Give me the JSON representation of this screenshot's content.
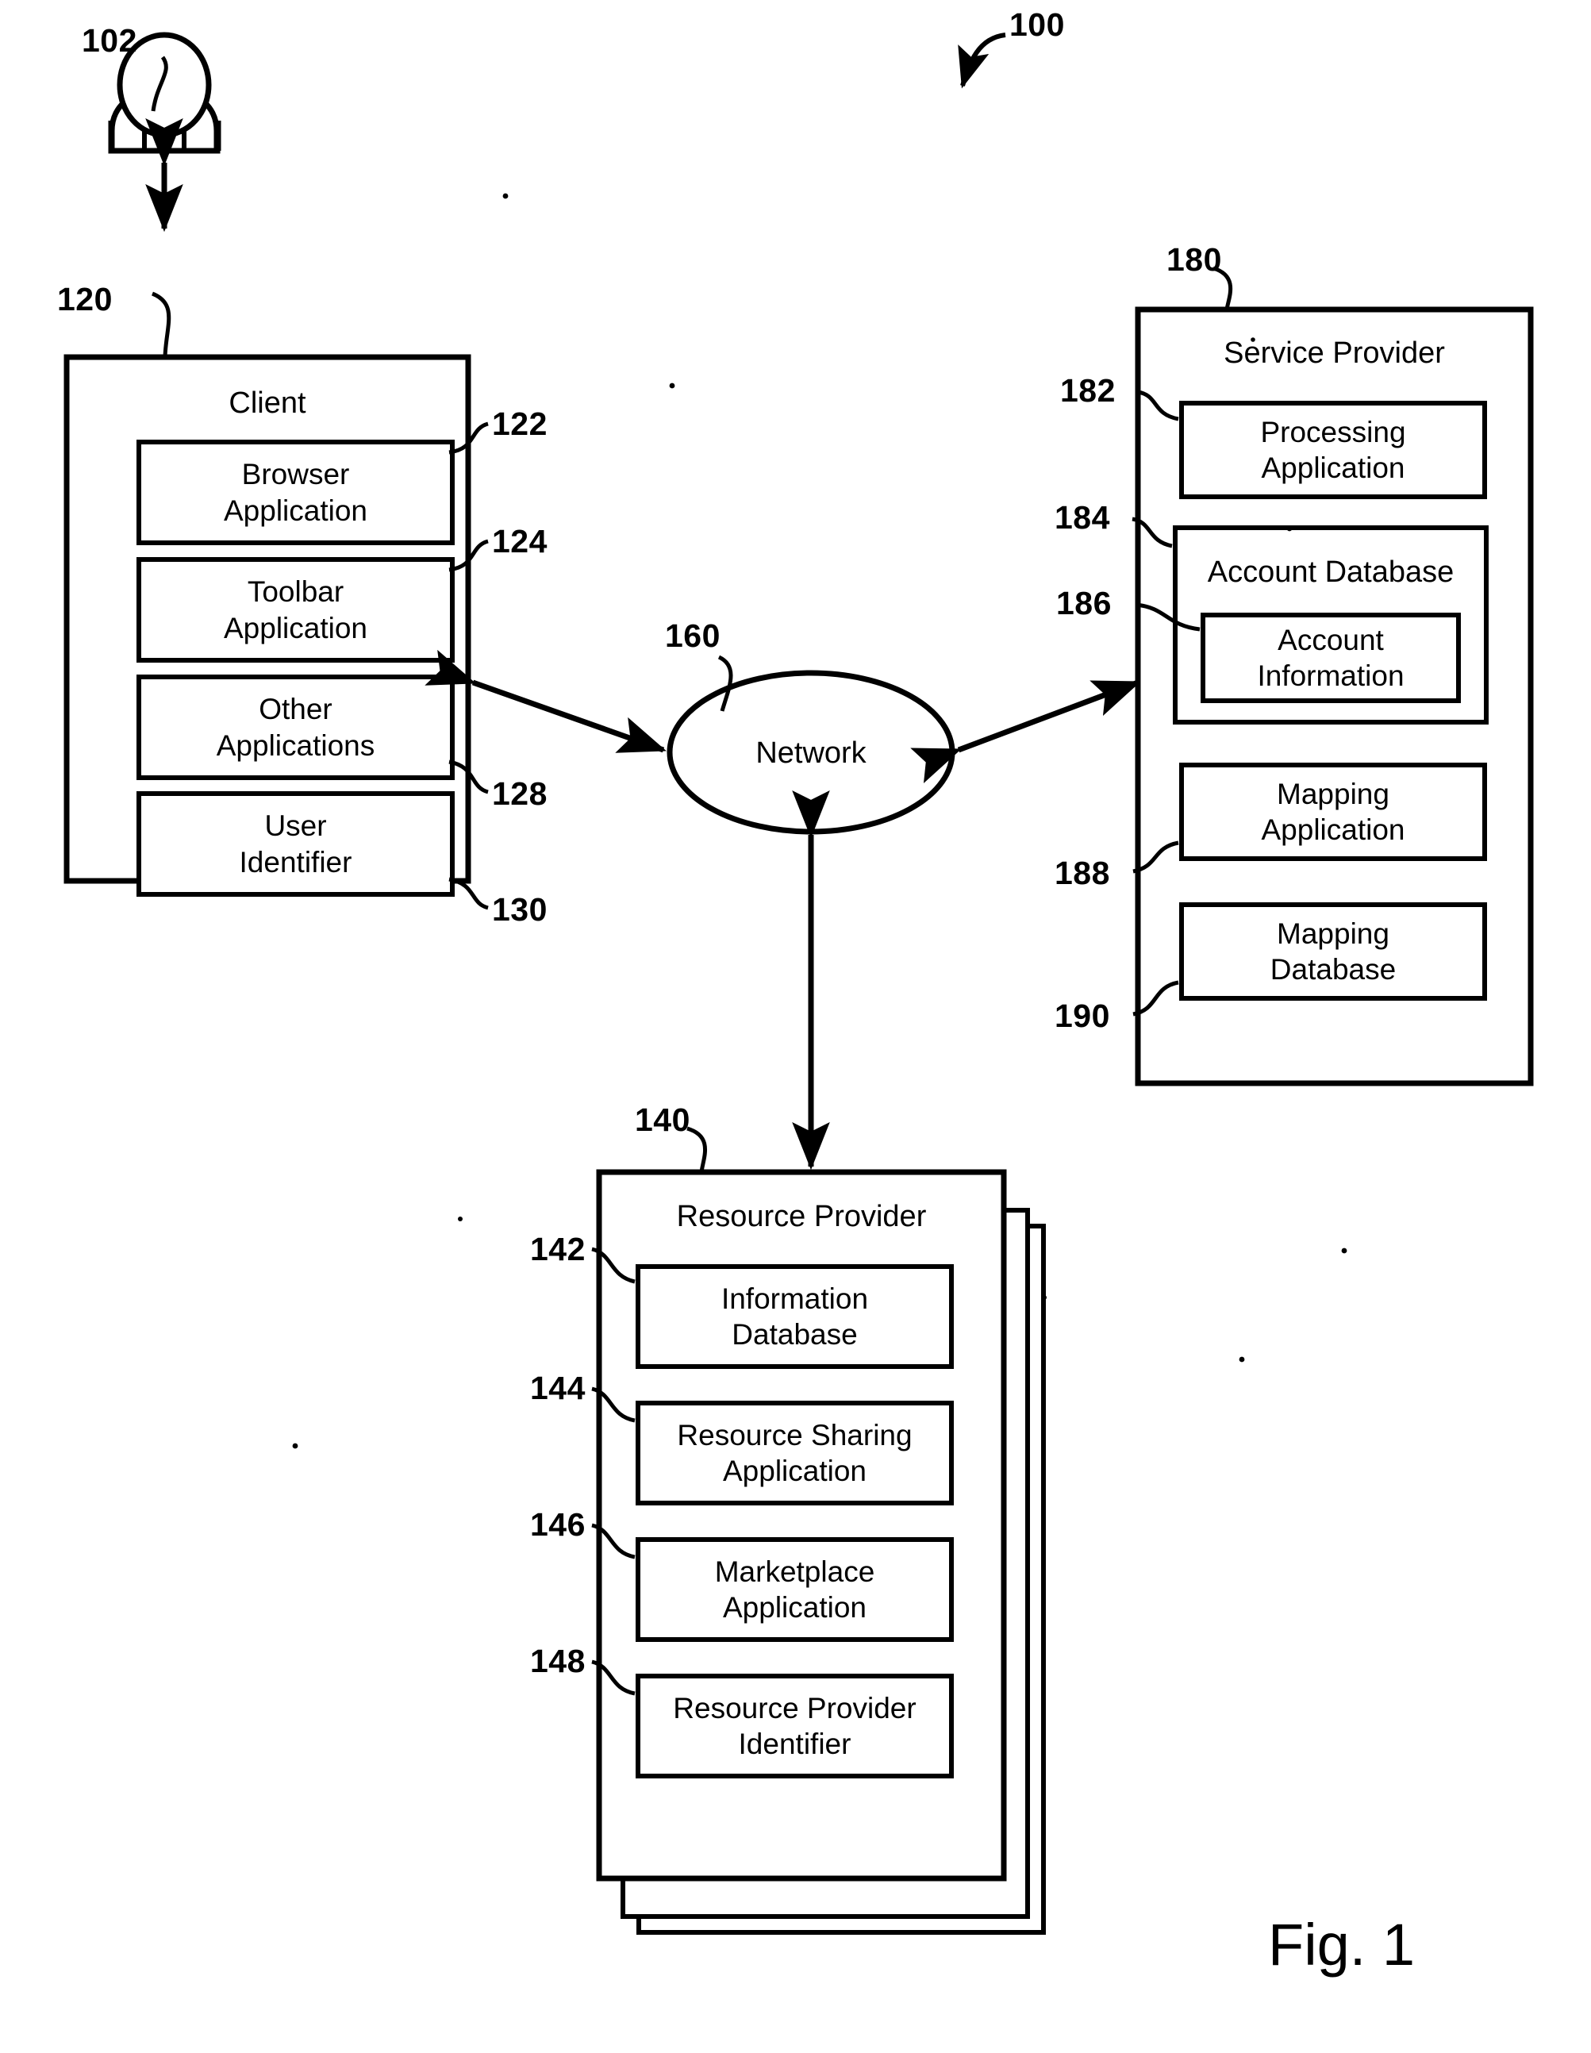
{
  "figure": {
    "caption": "Fig. 1",
    "system_ref": "100"
  },
  "actor": {
    "ref": "102",
    "name": "user-person-icon"
  },
  "client": {
    "ref": "120",
    "title": "Client",
    "modules": [
      {
        "ref": "122",
        "line1": "Browser",
        "line2": "Application"
      },
      {
        "ref": "124",
        "line1": "Toolbar",
        "line2": "Application"
      },
      {
        "ref": "128",
        "line1": "Other",
        "line2": "Applications"
      },
      {
        "ref": "130",
        "line1": "User",
        "line2": "Identifier"
      }
    ]
  },
  "network": {
    "ref": "160",
    "label": "Network"
  },
  "service_provider": {
    "ref": "180",
    "title": "Service Provider",
    "modules": [
      {
        "ref": "182",
        "line1": "Processing",
        "line2": "Application"
      }
    ],
    "account_database": {
      "ref": "184",
      "title": "Account Database",
      "inner": {
        "ref": "186",
        "line1": "Account",
        "line2": "Information"
      }
    },
    "modules_lower": [
      {
        "ref": "188",
        "line1": "Mapping",
        "line2": "Application"
      },
      {
        "ref": "190",
        "line1": "Mapping",
        "line2": "Database"
      }
    ]
  },
  "resource_provider": {
    "ref": "140",
    "title": "Resource Provider",
    "modules": [
      {
        "ref": "142",
        "line1": "Information",
        "line2": "Database"
      },
      {
        "ref": "144",
        "line1": "Resource Sharing",
        "line2": "Application"
      },
      {
        "ref": "146",
        "line1": "Marketplace",
        "line2": "Application"
      },
      {
        "ref": "148",
        "line1": "Resource Provider",
        "line2": "Identifier"
      }
    ]
  }
}
